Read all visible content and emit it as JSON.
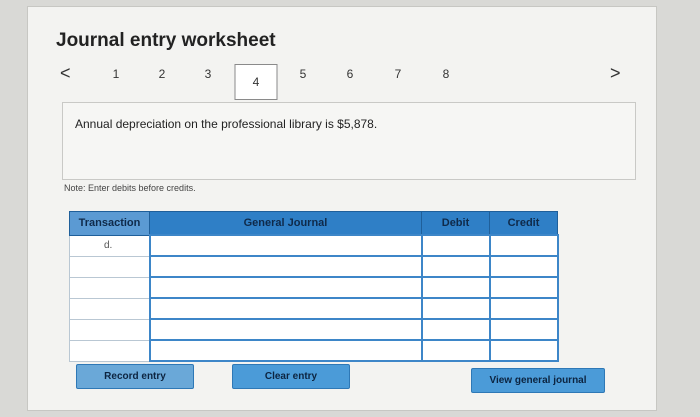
{
  "worksheet": {
    "title": "Journal entry worksheet",
    "nav_prev": "<",
    "nav_next": ">",
    "steps": [
      "1",
      "2",
      "3",
      "4",
      "5",
      "6",
      "7",
      "8"
    ],
    "active_step": "4"
  },
  "description": "Annual depreciation on the professional library is $5,878.",
  "note": "Note: Enter debits before credits.",
  "table": {
    "headers": {
      "transaction": "Transaction",
      "general_journal": "General Journal",
      "debit": "Debit",
      "credit": "Credit"
    },
    "rows": [
      {
        "transaction": "d.",
        "account": "",
        "debit": "",
        "credit": ""
      },
      {
        "transaction": "",
        "account": "",
        "debit": "",
        "credit": ""
      },
      {
        "transaction": "",
        "account": "",
        "debit": "",
        "credit": ""
      },
      {
        "transaction": "",
        "account": "",
        "debit": "",
        "credit": ""
      },
      {
        "transaction": "",
        "account": "",
        "debit": "",
        "credit": ""
      },
      {
        "transaction": "",
        "account": "",
        "debit": "",
        "credit": ""
      }
    ]
  },
  "buttons": {
    "record": "Record entry",
    "clear": "Clear entry",
    "view": "View general journal"
  },
  "colors": {
    "header_blue": "#2f7fc6",
    "button_blue": "#4b9bd8"
  }
}
